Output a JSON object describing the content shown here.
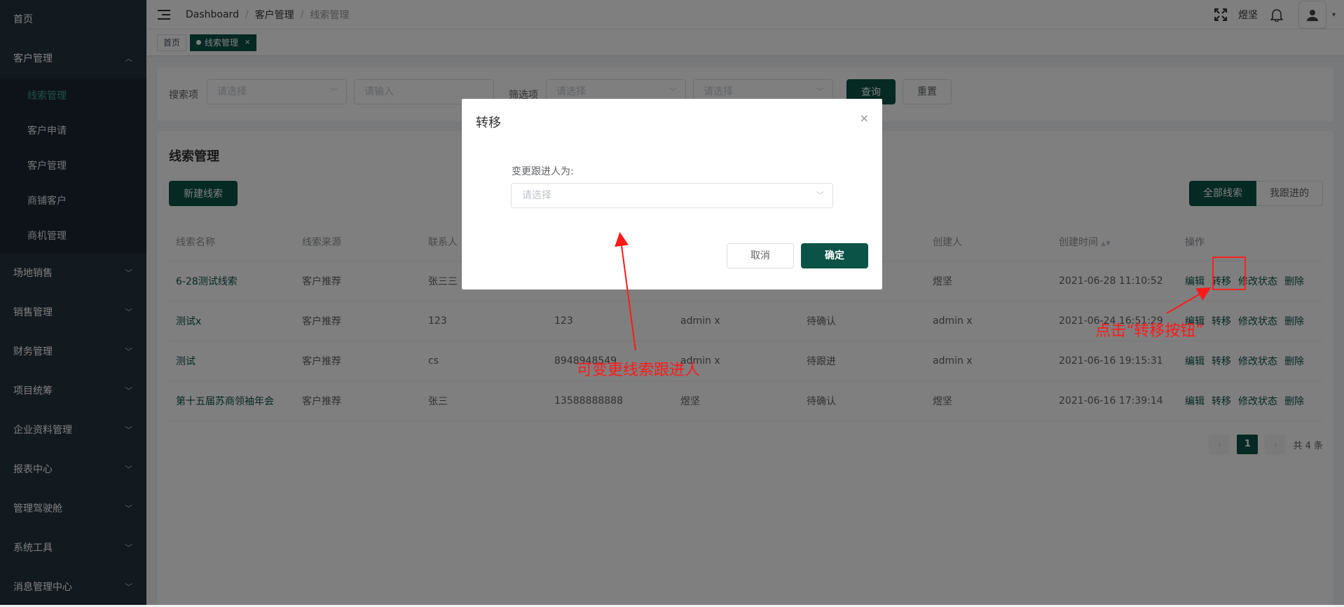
{
  "sidebar": {
    "items": [
      {
        "label": "首页"
      },
      {
        "label": "客户管理",
        "chev": "^"
      },
      {
        "label": "场地销售",
        "chev": "v"
      },
      {
        "label": "销售管理",
        "chev": "v"
      },
      {
        "label": "财务管理",
        "chev": "v"
      },
      {
        "label": "项目统筹",
        "chev": "v"
      },
      {
        "label": "企业资料管理",
        "chev": "v"
      },
      {
        "label": "报表中心",
        "chev": "v"
      },
      {
        "label": "管理驾驶舱",
        "chev": "v"
      },
      {
        "label": "系统工具",
        "chev": "v"
      },
      {
        "label": "消息管理中心",
        "chev": "v"
      }
    ],
    "subitems": [
      {
        "label": "线索管理"
      },
      {
        "label": "客户申请"
      },
      {
        "label": "客户管理"
      },
      {
        "label": "商铺客户"
      },
      {
        "label": "商机管理"
      }
    ]
  },
  "header": {
    "breadcrumb": [
      "Dashboard",
      "客户管理",
      "线索管理"
    ],
    "separator": "/",
    "user_name": "煜坚",
    "caret": "▾"
  },
  "tabs": {
    "home": "首页",
    "active": "线索管理",
    "close": "×"
  },
  "search": {
    "search_label": "搜索项",
    "search_select_placeholder": "请选择",
    "search_input_placeholder": "请输入",
    "filter_label": "筛选项",
    "filter_select1_placeholder": "请选择",
    "filter_select2_placeholder": "请选择",
    "query_button": "查询",
    "reset_button": "重置"
  },
  "card": {
    "title": "线索管理",
    "new_button": "新建线索",
    "seg_all": "全部线索",
    "seg_mine": "我跟进的"
  },
  "table": {
    "columns": [
      "线索名称",
      "线索来源",
      "联系人",
      "",
      "",
      "",
      "创建人",
      "创建时间",
      "操作"
    ],
    "rows": [
      {
        "name": "6-28测试线索",
        "source": "客户推荐",
        "contact": "张三三",
        "phone": "",
        "follower": "",
        "status": "",
        "creator": "煜坚",
        "time": "2021-06-28 11:10:52"
      },
      {
        "name": "测试x",
        "source": "客户推荐",
        "contact": "123",
        "phone": "123",
        "follower": "admin x",
        "status": "待确认",
        "creator": "admin x",
        "time": "2021-06-24 16:51:29"
      },
      {
        "name": "测试",
        "source": "客户推荐",
        "contact": "cs",
        "phone": "8948948549",
        "follower": "admin x",
        "status": "待跟进",
        "creator": "admin x",
        "time": "2021-06-16 19:15:31"
      },
      {
        "name": "第十五届苏商领袖年会",
        "source": "客户推荐",
        "contact": "张三",
        "phone": "13588888888",
        "follower": "煜坚",
        "status": "待确认",
        "creator": "煜坚",
        "time": "2021-06-16 17:39:14"
      }
    ],
    "ops": [
      "编辑",
      "转移",
      "修改状态",
      "删除"
    ]
  },
  "pager": {
    "prev": "‹",
    "page": "1",
    "next": "›",
    "total": "共 4 条"
  },
  "modal": {
    "title": "转移",
    "close": "×",
    "label": "变更跟进人为:",
    "select_placeholder": "请选择",
    "cancel": "取消",
    "confirm": "确定"
  },
  "annotations": {
    "arrow_text_1": "可变更线索跟进人",
    "arrow_text_2": "点击“转移按钮”",
    "color": "#ff1a1a"
  },
  "colors": {
    "primary": "#0b5346",
    "sidebar_bg": "#25323f",
    "sidebar_active": "#3fa58f"
  }
}
